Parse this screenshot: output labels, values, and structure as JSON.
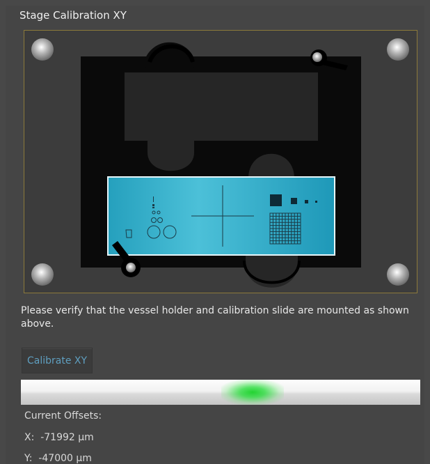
{
  "window": {
    "title": "Stage Calibration XY"
  },
  "message": "Please verify that the vessel holder and calibration slide are mounted as shown above.",
  "calibrate_button": {
    "label": "Calibrate XY"
  },
  "progress": {
    "indicator_position": 0.58,
    "accent_color": "#1ed232"
  },
  "offsets": {
    "label": "Current Offsets:",
    "x": {
      "prefix": "X:",
      "value": "-71992 µm"
    },
    "y": {
      "prefix": "Y:",
      "value": "-47000 µm"
    }
  },
  "colors": {
    "frame_border": "#8c7a3a",
    "slide": "#2aa6c4",
    "button_text": "#5f9fc0"
  }
}
